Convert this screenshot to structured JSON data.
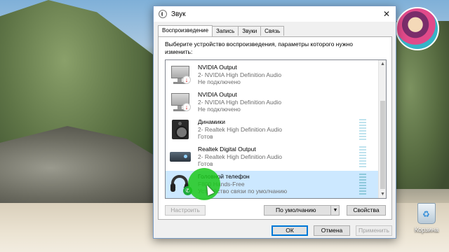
{
  "window": {
    "title": "Звук",
    "close_glyph": "✕"
  },
  "tabs": [
    {
      "label": "Воспроизведение",
      "active": true
    },
    {
      "label": "Запись",
      "active": false
    },
    {
      "label": "Звуки",
      "active": false
    },
    {
      "label": "Связь",
      "active": false
    }
  ],
  "instruction": "Выберите устройство воспроизведения, параметры которого нужно изменить:",
  "devices": [
    {
      "name": "NVIDIA Output",
      "driver": "2- NVIDIA High Definition Audio",
      "status": "Не подключено",
      "icon": "monitor-disconnected-icon",
      "selected": false
    },
    {
      "name": "NVIDIA Output",
      "driver": "2- NVIDIA High Definition Audio",
      "status": "Не подключено",
      "icon": "monitor-disconnected-icon",
      "selected": false
    },
    {
      "name": "Динамики",
      "driver": "2- Realtek High Definition Audio",
      "status": "Готов",
      "icon": "speaker-icon",
      "selected": false
    },
    {
      "name": "Realtek Digital Output",
      "driver": "2- Realtek High Definition Audio",
      "status": "Готов",
      "icon": "digital-output-icon",
      "selected": false
    },
    {
      "name": "Головной телефон",
      "driver": "F800 Hands-Free",
      "status": "Устройство связи по умолчанию",
      "icon": "headset-phone-icon",
      "selected": true
    }
  ],
  "buttons": {
    "configure": "Настроить",
    "set_default": "По умолчанию",
    "set_default_arrow": "▼",
    "properties": "Свойства",
    "ok": "ОК",
    "cancel": "Отмена",
    "apply": "Применить"
  },
  "scrollbar": {
    "up": "▲",
    "down": "▼"
  },
  "desktop": {
    "recycle_bin_label": "Корзина"
  },
  "colors": {
    "selection": "#cce8ff",
    "accent": "#0078d7",
    "cursor_highlight": "#1cc81c"
  }
}
